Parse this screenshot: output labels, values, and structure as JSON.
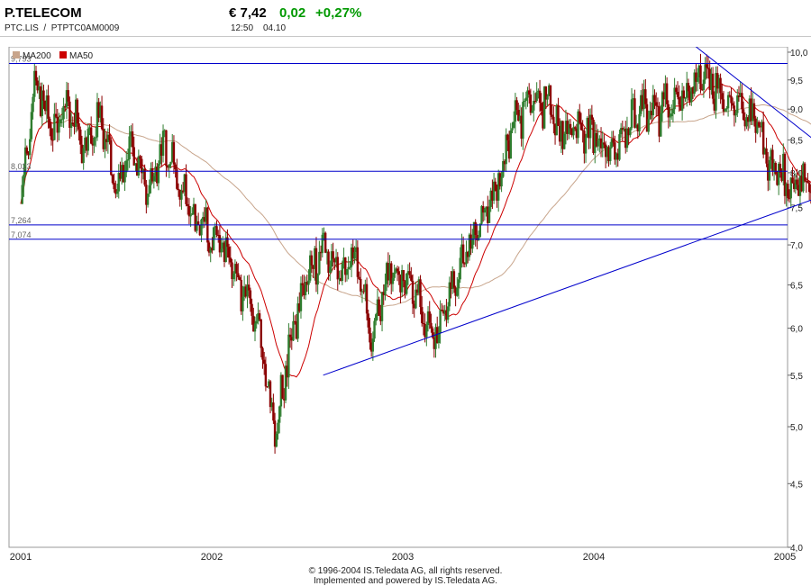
{
  "header": {
    "name": "P.TELECOM",
    "ticker": "PTC.LIS",
    "separator": "/",
    "isin": "PTPTC0AM0009",
    "price": "€ 7,42",
    "change": "0,02",
    "change_pct": "+0,27%",
    "time": "12:50",
    "date": "04.10"
  },
  "legend": [
    {
      "label": "MA200",
      "color": "#c8a58c"
    },
    {
      "label": "MA50",
      "color": "#cc0000"
    }
  ],
  "colors": {
    "up": "#2f7d2f",
    "down": "#8b0000",
    "trend": "#0000cc",
    "ma50": "#cc0000",
    "ma200": "#c8a58c",
    "positive": "#009900"
  },
  "footer": {
    "line1": "© 1996-2004 IS.Teledata AG, all rights reserved.",
    "line2": "Implemented and powered by IS.Teledata AG."
  },
  "chart_data": {
    "type": "candlestick",
    "y_scale": "log",
    "ylim": [
      4.0,
      10.1
    ],
    "y_ticks": [
      "10,0",
      "9,5",
      "9,0",
      "8,5",
      "8,0",
      "7,5",
      "7,0",
      "6,5",
      "6,0",
      "5,5",
      "5,0",
      "4,5",
      "4,0"
    ],
    "x_labels": [
      "2001",
      "2002",
      "2003",
      "2004",
      "2005"
    ],
    "grid": false,
    "legend_position": "top-left",
    "horizontal_levels": [
      {
        "value": 9.793,
        "label": "9,793"
      },
      {
        "value": 8.023,
        "label": "8,023"
      },
      {
        "value": 7.264,
        "label": "7,264"
      },
      {
        "value": 7.074,
        "label": "7,074"
      }
    ],
    "trendlines": [
      {
        "from": [
          "2002-08",
          5.5
        ],
        "to": [
          "2005-06",
          7.88
        ]
      },
      {
        "from": [
          "2004-07",
          10.2
        ],
        "to": [
          "2005-06",
          7.9
        ]
      }
    ],
    "price_path": [
      [
        "2001-01",
        7.5
      ],
      [
        "2001-02",
        9.5
      ],
      [
        "2001-03",
        8.6
      ],
      [
        "2001-04",
        9.1
      ],
      [
        "2001-05",
        8.3
      ],
      [
        "2001-06",
        8.9
      ],
      [
        "2001-07",
        7.8
      ],
      [
        "2001-08",
        8.4
      ],
      [
        "2001-09",
        7.7
      ],
      [
        "2001-10",
        8.4
      ],
      [
        "2001-11",
        7.8
      ],
      [
        "2001-12",
        7.3
      ],
      [
        "2002-01",
        7.1
      ],
      [
        "2002-02",
        6.9
      ],
      [
        "2002-03",
        6.4
      ],
      [
        "2002-04",
        6.0
      ],
      [
        "2002-05",
        4.9
      ],
      [
        "2002-06",
        5.9
      ],
      [
        "2002-07",
        6.6
      ],
      [
        "2002-08",
        7.0
      ],
      [
        "2002-09",
        6.6
      ],
      [
        "2002-10",
        6.9
      ],
      [
        "2002-11",
        5.8
      ],
      [
        "2002-12",
        6.6
      ],
      [
        "2003-01",
        6.6
      ],
      [
        "2003-02",
        6.3
      ],
      [
        "2003-03",
        5.9
      ],
      [
        "2003-04",
        6.4
      ],
      [
        "2003-05",
        6.9
      ],
      [
        "2003-06",
        7.3
      ],
      [
        "2003-07",
        7.9
      ],
      [
        "2003-08",
        8.7
      ],
      [
        "2003-09",
        9.2
      ],
      [
        "2003-10",
        9.1
      ],
      [
        "2003-11",
        8.6
      ],
      [
        "2003-12",
        8.8
      ],
      [
        "2004-01",
        8.6
      ],
      [
        "2004-02",
        8.3
      ],
      [
        "2004-03",
        8.7
      ],
      [
        "2004-04",
        9.0
      ],
      [
        "2004-05",
        9.0
      ],
      [
        "2004-06",
        9.1
      ],
      [
        "2004-07",
        9.2
      ],
      [
        "2004-08",
        9.7
      ],
      [
        "2004-09",
        9.2
      ],
      [
        "2004-10",
        9.0
      ],
      [
        "2004-11",
        8.9
      ],
      [
        "2004-12",
        8.2
      ],
      [
        "2005-01",
        7.9
      ],
      [
        "2005-02",
        7.8
      ],
      [
        "2005-03",
        8.0
      ],
      [
        "2005-04",
        7.7
      ],
      [
        "2005-05",
        7.6
      ],
      [
        "2005-06",
        7.42
      ]
    ]
  }
}
